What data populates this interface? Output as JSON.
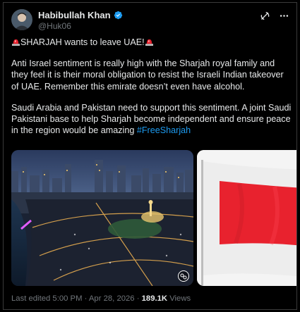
{
  "author": {
    "display_name": "Habibullah Khan",
    "handle": "@Huk06"
  },
  "icons": {
    "verified": "verified-badge-icon",
    "grok": "grok-icon",
    "more": "more-icon",
    "siren": "police-siren-emoji-icon",
    "gif": "gif-icon"
  },
  "tweet": {
    "headline": "SHARJAH wants to leave UAE!",
    "paragraph1": "Anti Israel sentiment is really high with the Sharjah royal family and they feel it is their moral obligation to resist the Israeli Indian takeover of UAE. Remember this emirate doesn’t even have alcohol.",
    "paragraph2": "Saudi Arabia and Pakistan need to support this sentiment. A joint Saudi Pakistani base to help Sharjah become independent and ensure peace in the region would be amazing",
    "hashtag": "#FreeSharjah"
  },
  "meta": {
    "edited": "Last edited 5:00 PM · Apr 28, 2026 · ",
    "views_count": "189.1K",
    "views_label": " Views"
  },
  "colors": {
    "background": "#000000",
    "text": "#e7e9ea",
    "secondary": "#71767b",
    "link": "#1d9bf0",
    "flag_red": "#e8222e"
  }
}
